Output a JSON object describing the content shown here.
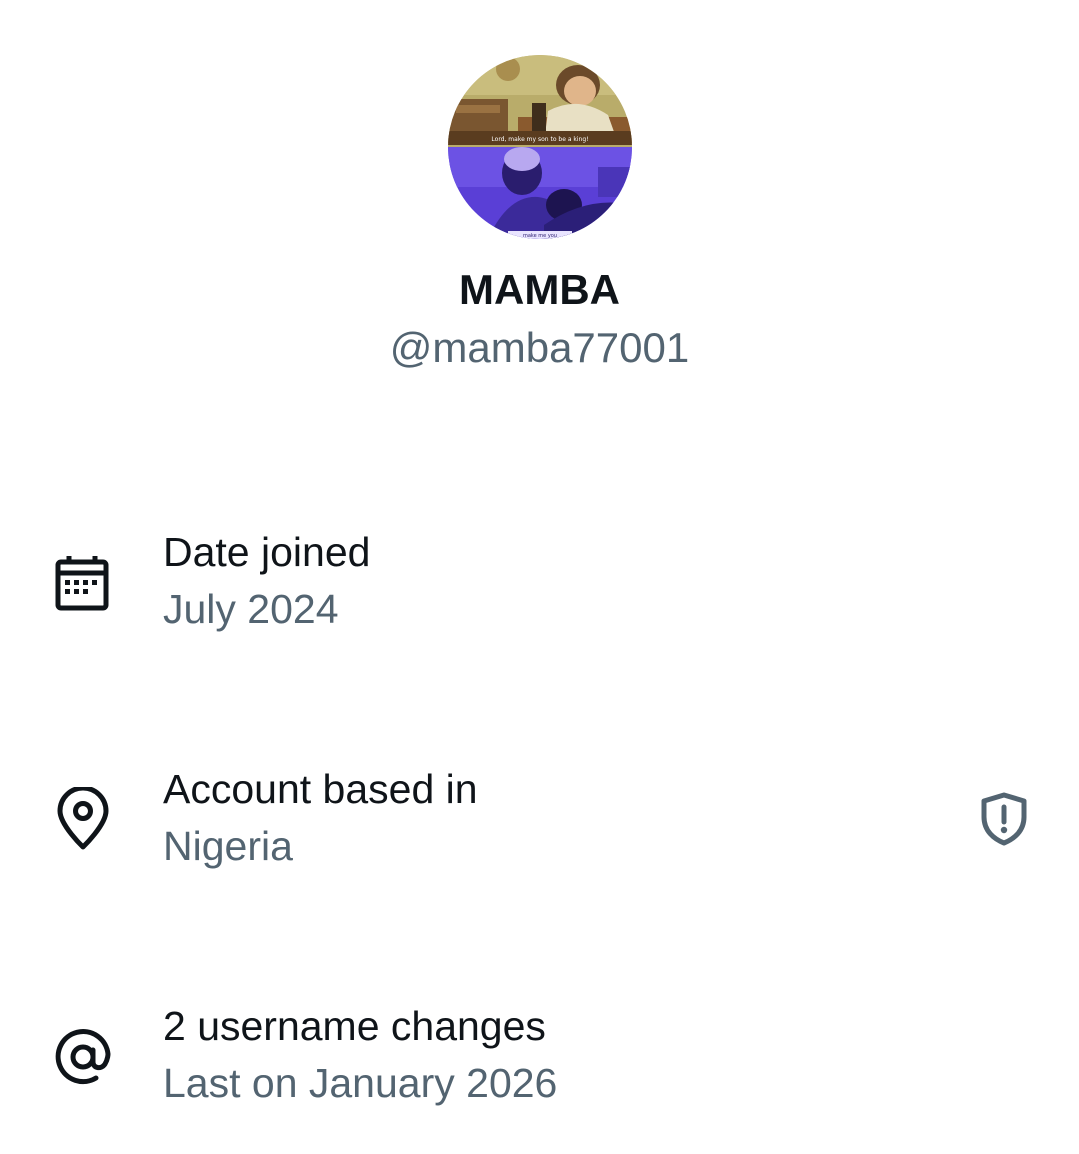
{
  "profile": {
    "display_name": "MAMBA",
    "handle": "@mamba77001",
    "avatar_caption_top": "Lord, make my son to be a king!",
    "avatar_caption_bottom": "make me you"
  },
  "rows": [
    {
      "icon": "calendar-icon",
      "title": "Date joined",
      "subtitle": "July 2024"
    },
    {
      "icon": "location-pin-icon",
      "title": "Account based in",
      "subtitle": "Nigeria",
      "action_icon": "shield-alert-icon"
    },
    {
      "icon": "at-sign-icon",
      "title": "2 username changes",
      "subtitle": "Last on January 2026"
    }
  ],
  "colors": {
    "primary_text": "#0f1419",
    "secondary_text": "#536471",
    "background": "#ffffff"
  }
}
